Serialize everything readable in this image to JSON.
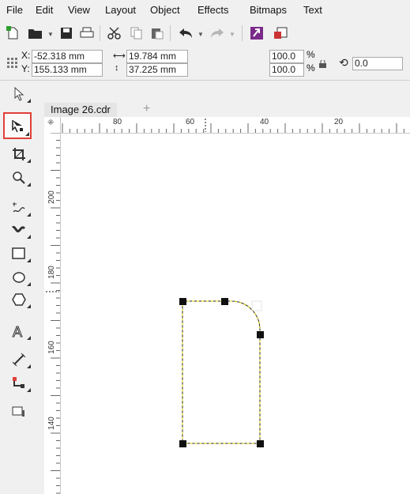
{
  "menu": [
    "File",
    "Edit",
    "View",
    "Layout",
    "Object",
    "Effects",
    "Bitmaps",
    "Text"
  ],
  "toolbar": {
    "icons": [
      "new-document-icon",
      "open-icon",
      "save-icon",
      "print-icon",
      "cut-icon",
      "copy-icon",
      "paste-icon",
      "undo-icon",
      "redo-icon",
      "import-icon",
      "export-icon"
    ]
  },
  "property_bar": {
    "x_label": "X:",
    "x_value": "-52.318 mm",
    "y_label": "Y:",
    "y_value": "155.133 mm",
    "width_value": "19.784 mm",
    "height_value": "37.225 mm",
    "scale_x": "100.0",
    "scale_y": "100.0",
    "percent": "%",
    "rotation": "0.0"
  },
  "toolbox": [
    "pick-tool",
    "shape-tool",
    "crop-tool",
    "zoom-tool",
    "freehand-tool",
    "artistic-media-tool",
    "rectangle-tool",
    "ellipse-tool",
    "polygon-tool",
    "text-tool",
    "parallel-dimension-tool",
    "connector-tool",
    "drop-shadow-tool"
  ],
  "document": {
    "tab_title": "Image 26.cdr",
    "add_tab": "+"
  },
  "rulers": {
    "horizontal": [
      "80",
      "60",
      "40",
      "20"
    ],
    "vertical": [
      "200",
      "180",
      "160",
      "140"
    ]
  },
  "colors": {
    "highlight": "#e0403a",
    "selection_dash": "#e8d400"
  }
}
